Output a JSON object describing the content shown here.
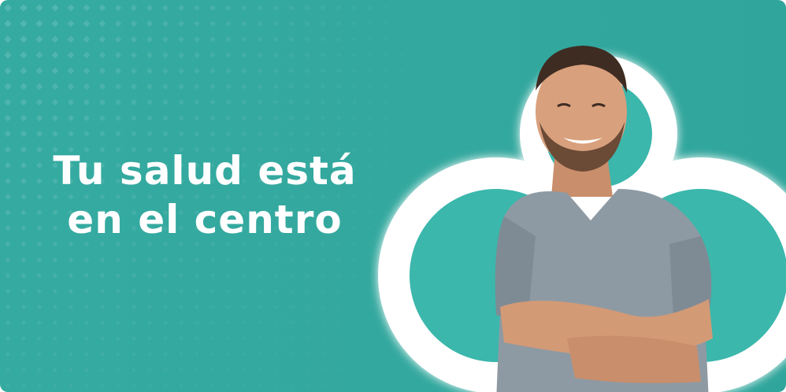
{
  "banner": {
    "headline_line1": "Tu salud está",
    "headline_line2": "en el centro"
  },
  "colors": {
    "background": "#33a89e",
    "text": "#ffffff",
    "logo_outline": "#ffffff",
    "logo_fill": "#3bb7ac",
    "shirt": "#8e9aa3"
  },
  "icons": {
    "logo": "brand-logo-outline-icon",
    "photo": "smiling-man-photo"
  }
}
